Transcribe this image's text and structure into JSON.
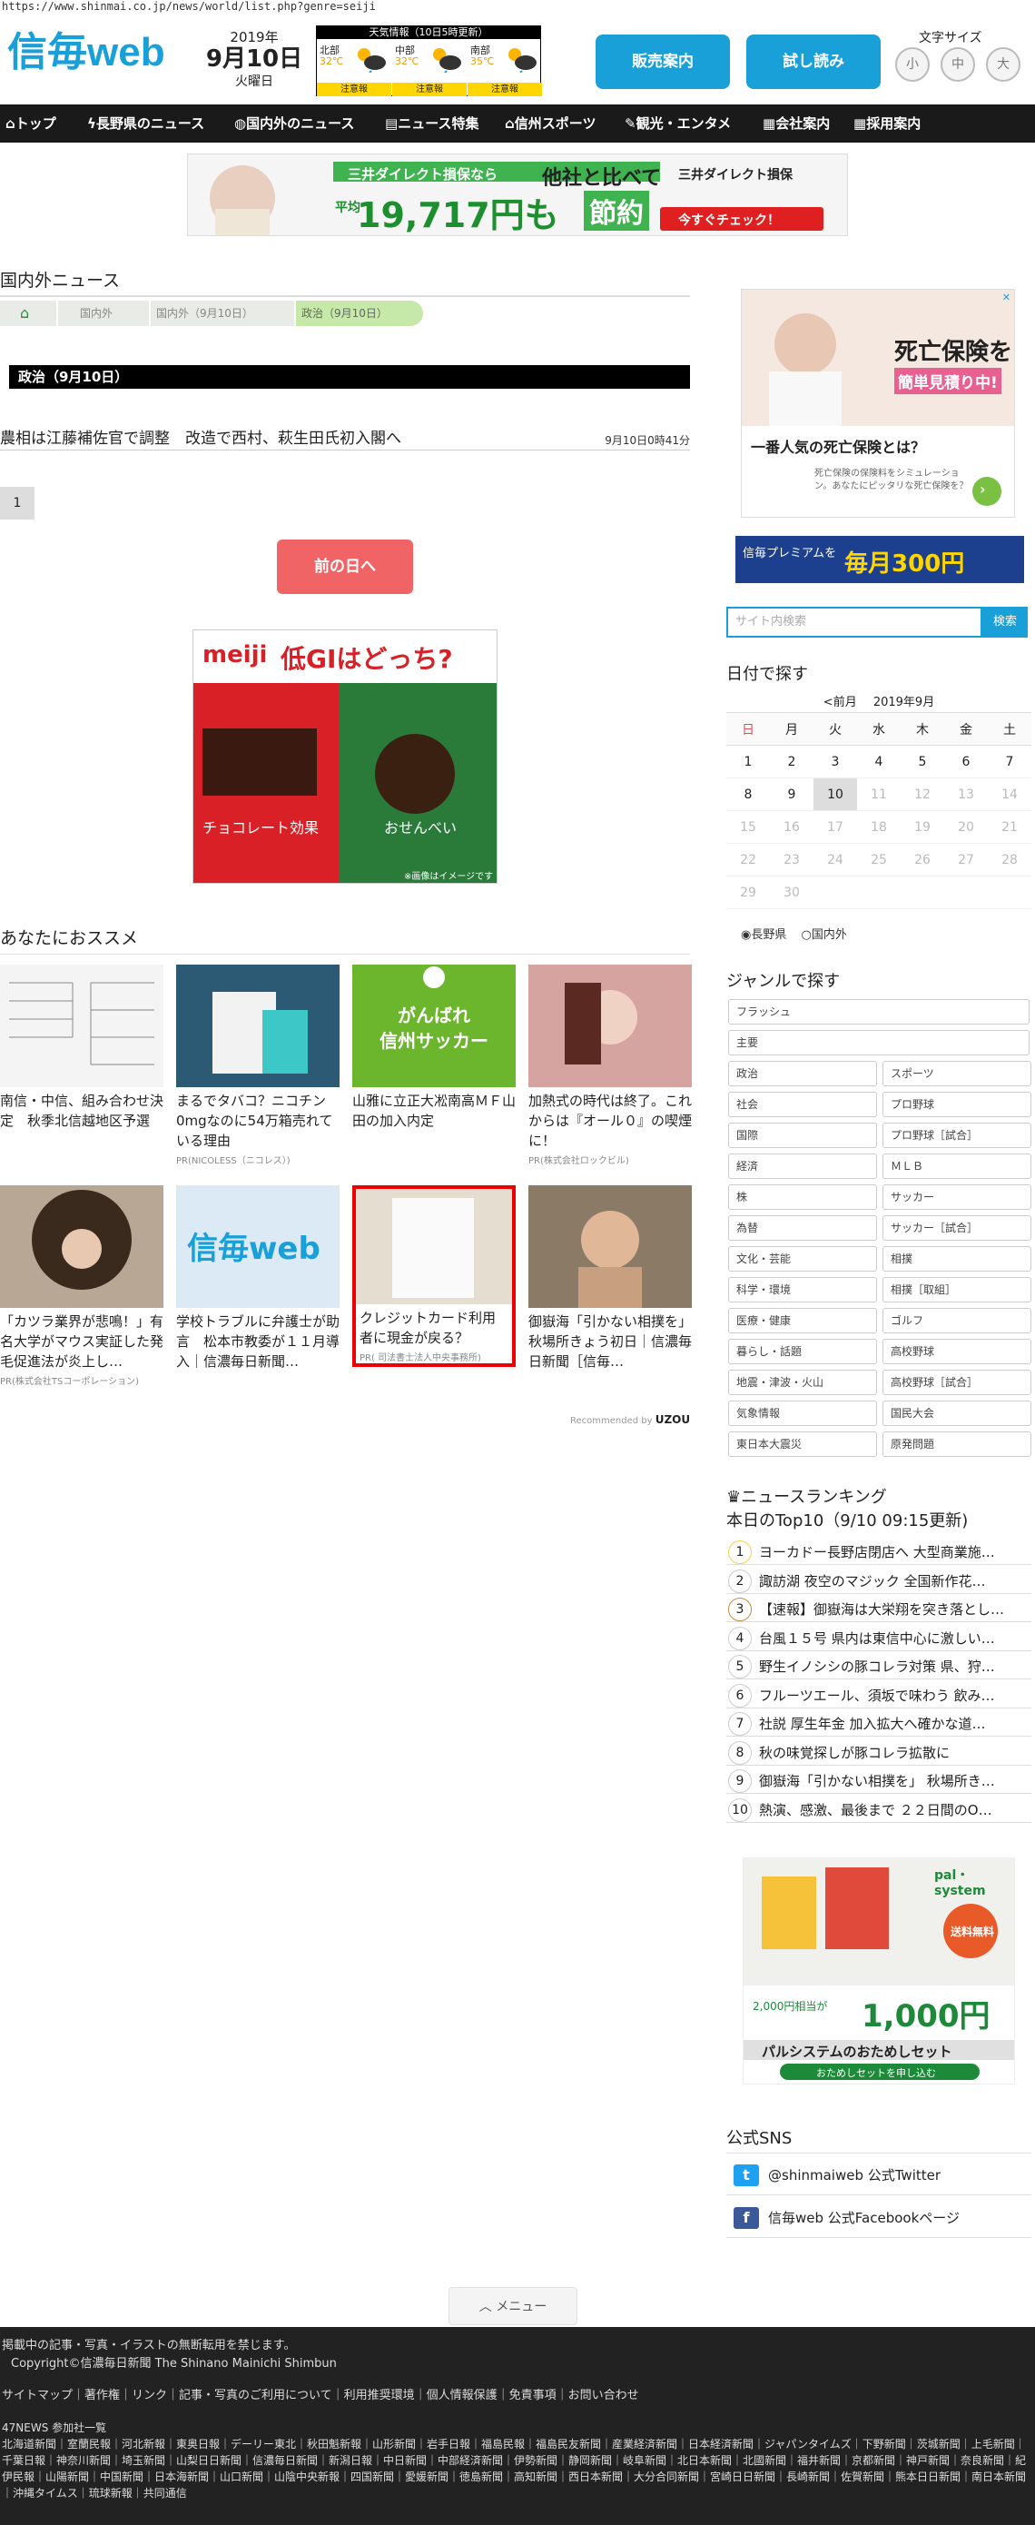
{
  "url": "https://www.shinmai.co.jp/news/world/list.php?genre=seiji",
  "logo": "信毎web",
  "date": {
    "year": "2019年",
    "monthday": "9月10日",
    "weekday": "火曜日"
  },
  "weather": {
    "title": "天気情報（10日5時更新）",
    "regions": [
      {
        "name": "北部",
        "temp": "32℃",
        "warn": "注意報"
      },
      {
        "name": "中部",
        "temp": "32℃",
        "warn": "注意報"
      },
      {
        "name": "南部",
        "temp": "35℃",
        "warn": "注意報"
      }
    ]
  },
  "header": {
    "sales_btn": "販売案内",
    "trial_btn": "試し読み",
    "fontsize_label": "文字サイズ",
    "fs_small": "小",
    "fs_mid": "中",
    "fs_large": "大"
  },
  "nav": [
    "トップ",
    "長野県のニュース",
    "国内外のニュース",
    "ニュース特集",
    "信州スポーツ",
    "観光・エンタメ",
    "会社案内",
    "採用案内"
  ],
  "banner": {
    "brand": "三井ダイレクト損保なら",
    "tag": "他社と比べて",
    "price": "19,717円も",
    "avg": "平均",
    "save": "節約",
    "cta": "今すぐチェック！",
    "logo": "三井ダイレクト損保"
  },
  "section_title": "国内外ニュース",
  "breadcrumb": [
    "国内外",
    "国内外（9月10日）",
    "政治（9月10日）"
  ],
  "genre_heading": "政治（9月10日）",
  "article": {
    "title": "農相は江藤補佐官で調整　改造で西村、萩生田氏初入閣へ",
    "time": "9月10日0時41分"
  },
  "pager": "1",
  "prev_day": "前の日へ",
  "ad_meiji": {
    "brand": "meiji",
    "headline": "低GIはどっち?",
    "left": "チョコレート効果",
    "right": "おせんべい",
    "note": "※画像はイメージです"
  },
  "recommend_title": "あなたにおススメ",
  "recommend": [
    {
      "title": "南信・中信、組み合わせ決定　秋季北信越地区予選",
      "pr": ""
    },
    {
      "title": "まるでタバコ？ニコチン0mgなのに54万箱売れている理由",
      "pr": "PR(NICOLESS（ニコレス）)"
    },
    {
      "title": "山雅に立正大凇南高ＭＦ山田の加入内定",
      "pr": ""
    },
    {
      "title": "加熱式の時代は終了。これからは『オール０』の喫煙に！",
      "pr": "PR(株式会社ロックビル)"
    },
    {
      "title": "「カツラ業界が悲鳴！」有名大学がマウス実証した発毛促進法が炎上し…",
      "pr": "PR(株式会社TSコーポレーション)"
    },
    {
      "title": "学校トラブルに弁護士が助言　松本市教委が１１月導入｜信濃毎日新聞…",
      "pr": ""
    },
    {
      "title": "クレジットカード利用者に現金が戻る？",
      "pr": "PR( 司法書士法人中央事務所)"
    },
    {
      "title": "御嶽海「引かない相撲を」　秋場所きょう初日｜信濃毎日新聞［信毎…",
      "pr": ""
    }
  ],
  "soccer_card": {
    "top": "がんばれ",
    "bottom": "信州サッカー"
  },
  "recommended_by": "Recommended by",
  "side_ad": {
    "headline": "死亡保険を",
    "sub": "簡単見積り中!",
    "body": "一番人気の死亡保険とは？",
    "desc": "死亡保険の保険料をシミュレーション。あなたにピッタリな死亡保険を？"
  },
  "premium": {
    "label": "信毎プレミアムを",
    "amount": "毎月300円"
  },
  "search": {
    "placeholder": "サイト内検索",
    "button": "検索"
  },
  "calendar": {
    "heading": "日付で探す",
    "prev": "<前月",
    "month": "2019年9月",
    "weekdays": [
      "日",
      "月",
      "火",
      "水",
      "木",
      "金",
      "土"
    ],
    "weeks": [
      [
        "1",
        "2",
        "3",
        "4",
        "5",
        "6",
        "7"
      ],
      [
        "8",
        "9",
        "10",
        "11",
        "12",
        "13",
        "14"
      ],
      [
        "15",
        "16",
        "17",
        "18",
        "19",
        "20",
        "21"
      ],
      [
        "22",
        "23",
        "24",
        "25",
        "26",
        "27",
        "28"
      ],
      [
        "29",
        "30",
        "",
        "",
        "",
        "",
        ""
      ]
    ],
    "region_a": "長野県",
    "region_b": "国内外"
  },
  "genre_heading_side": "ジャンルで探す",
  "genres_full": [
    "フラッシュ",
    "主要"
  ],
  "genres": [
    "政治",
    "スポーツ",
    "社会",
    "プロ野球",
    "国際",
    "プロ野球［試合］",
    "経済",
    "ＭＬＢ",
    "株",
    "サッカー",
    "為替",
    "サッカー［試合］",
    "文化・芸能",
    "相撲",
    "科学・環境",
    "相撲［取組］",
    "医療・健康",
    "ゴルフ",
    "暮らし・話題",
    "高校野球",
    "地震・津波・火山",
    "高校野球［試合］",
    "気象情報",
    "国民大会",
    "東日本大震災",
    "原発問題"
  ],
  "ranking": {
    "heading": "ニュースランキング",
    "sub": "本日のTop10（9/10 09:15更新)",
    "items": [
      "ヨーカドー長野店閉店へ 大型商業施…",
      "諏訪湖 夜空のマジック 全国新作花…",
      "【速報】御嶽海は大栄翔を突き落とし…",
      "台風１５号 県内は東信中心に激しい…",
      "野生イノシシの豚コレラ対策 県、狩…",
      "フルーツエール、須坂で味わう 飲み…",
      "社説 厚生年金 加入拡大へ確かな道…",
      "秋の味覚探しが豚コレラ拡散に",
      "御嶽海「引かない相撲を」 秋場所き…",
      "熱演、感激、最後まで ２２日間のO…"
    ]
  },
  "pal": {
    "brand": "pal・system",
    "free": "送料無料",
    "price": "1,000円",
    "before": "2,000円相当が",
    "text": "パルシステムのおためしセット",
    "cta": "おためしセットを申し込む"
  },
  "sns": {
    "heading": "公式SNS",
    "twitter": "@shinmaiweb 公式Twitter",
    "facebook": "信毎web 公式Facebookページ"
  },
  "menu_button": "メニュー",
  "footer": {
    "notice": "掲載中の記事・写真・イラストの無断転用を禁じます。",
    "copyright": "Copyright©信濃毎日新聞 The Shinano Mainichi Shimbun",
    "links": "サイトマップ｜著作権｜リンク｜記事・写真のご利用について｜利用推奨環境｜個人情報保護｜免責事項｜お問い合わせ",
    "news47": "47NEWS 参加社一覧",
    "papers": "北海道新聞｜室蘭民報｜河北新報｜東奥日報｜デーリー東北｜秋田魁新報｜山形新聞｜岩手日報｜福島民報｜福島民友新聞｜産業経済新聞｜日本経済新聞｜ジャパンタイムズ｜下野新聞｜茨城新聞｜上毛新聞｜千葉日報｜神奈川新聞｜埼玉新聞｜山梨日日新聞｜信濃毎日新聞｜新潟日報｜中日新聞｜中部経済新聞｜伊勢新聞｜静岡新聞｜岐阜新聞｜北日本新聞｜北國新聞｜福井新聞｜京都新聞｜神戸新聞｜奈良新聞｜紀伊民報｜山陽新聞｜中国新聞｜日本海新聞｜山口新聞｜山陰中央新報｜四国新聞｜愛媛新聞｜徳島新聞｜高知新聞｜西日本新聞｜大分合同新聞｜宮崎日日新聞｜長崎新聞｜佐賀新聞｜熊本日日新聞｜南日本新聞｜沖縄タイムス｜琉球新報｜共同通信"
  },
  "colors": {
    "accent": "#1aa0d8",
    "nav": "#1a1a1a",
    "prev_btn": "#f06466",
    "warn": "#ffd600",
    "footer": "#222222"
  }
}
